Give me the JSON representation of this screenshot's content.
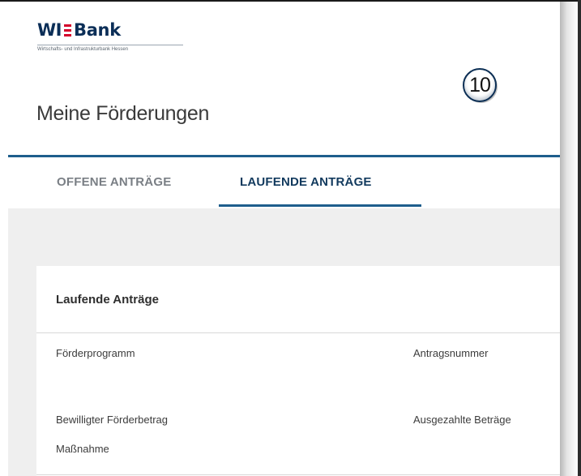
{
  "logo": {
    "wordmark_left": "WI",
    "wordmark_right": "Bank",
    "tagline": "Wirtschafts- und Infrastrukturbank Hessen"
  },
  "badge": {
    "text": "10"
  },
  "header": {
    "title": "Meine Förderungen"
  },
  "tabs": [
    {
      "label": "OFFENE ANTRÄGE",
      "active": false
    },
    {
      "label": "LAUFENDE ANTRÄGE",
      "active": true
    }
  ],
  "card": {
    "title": "Laufende Anträge",
    "fields": [
      {
        "label": "Förderprogramm"
      },
      {
        "label": "Antragsnummer"
      },
      {
        "label": "Bewilligter Förderbetrag"
      },
      {
        "label": "Ausgezahlte Beträge"
      },
      {
        "label": "Maßnahme"
      }
    ]
  },
  "colors": {
    "brand_navy": "#0b2e57",
    "brand_red": "#d4002a",
    "accent_blue": "#1e5e8c",
    "content_background": "#efefef"
  }
}
